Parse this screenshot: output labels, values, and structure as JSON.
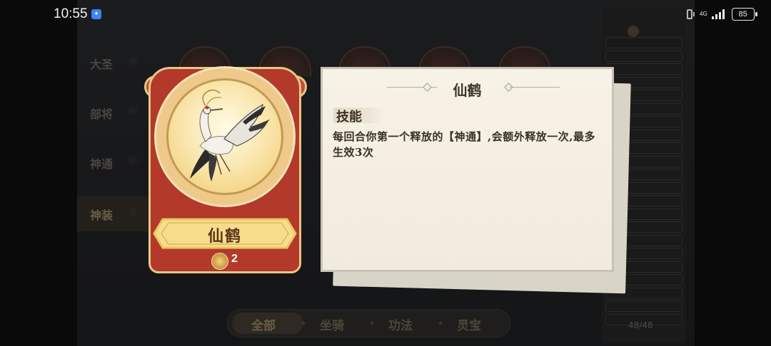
{
  "status_bar": {
    "time": "10:55",
    "network": "4G",
    "battery": "85"
  },
  "left_categories": [
    {
      "label": "大圣",
      "active": false
    },
    {
      "label": "部将",
      "active": false
    },
    {
      "label": "神通",
      "active": false
    },
    {
      "label": "神装",
      "active": true
    }
  ],
  "card": {
    "name": "仙鹤",
    "cost": "2"
  },
  "detail_panel": {
    "title": "仙鹤",
    "section_heading": "技能",
    "description": "每回合你第一个释放的【神通】,会额外释放一次,最多生效3次"
  },
  "right_list": {
    "items": [
      "",
      "",
      "",
      "",
      "",
      "",
      "",
      "",
      "",
      "",
      "",
      "",
      "",
      "",
      "",
      "",
      "",
      "",
      "",
      "",
      "",
      ""
    ],
    "count": "48/48"
  },
  "bottom_tabs": [
    {
      "label": "全部",
      "active": true
    },
    {
      "label": "坐骑",
      "active": false
    },
    {
      "label": "功法",
      "active": false
    },
    {
      "label": "灵宝",
      "active": false
    }
  ],
  "colors": {
    "card_red": "#b3392a",
    "card_gold": "#e5c785",
    "paper": "#f4efe2"
  }
}
